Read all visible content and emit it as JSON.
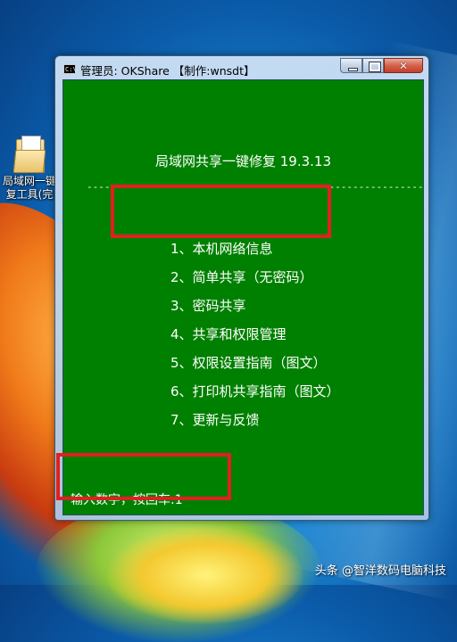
{
  "desktop": {
    "icon_label": "局域网一键\n复工具(完"
  },
  "window": {
    "title": "管理员:  OKShare  【制作:wnsdt】",
    "console_icon_text": "C:\\"
  },
  "console": {
    "heading": "局域网共享一键修复 19.3.13",
    "divider": "------------------------------------------------------------",
    "menu": [
      "1、本机网络信息",
      "2、简单共享（无密码）",
      "3、密码共享",
      "4、共享和权限管理",
      "5、权限设置指南（图文）",
      "6、打印机共享指南（图文）",
      "7、更新与反馈"
    ],
    "prompt": "输入数字，按回车:1"
  },
  "watermark": "头条 @智洋数码电脑科技",
  "colors": {
    "console_bg": "#008000",
    "console_text": "#ffffff",
    "highlight": "#e02020"
  }
}
